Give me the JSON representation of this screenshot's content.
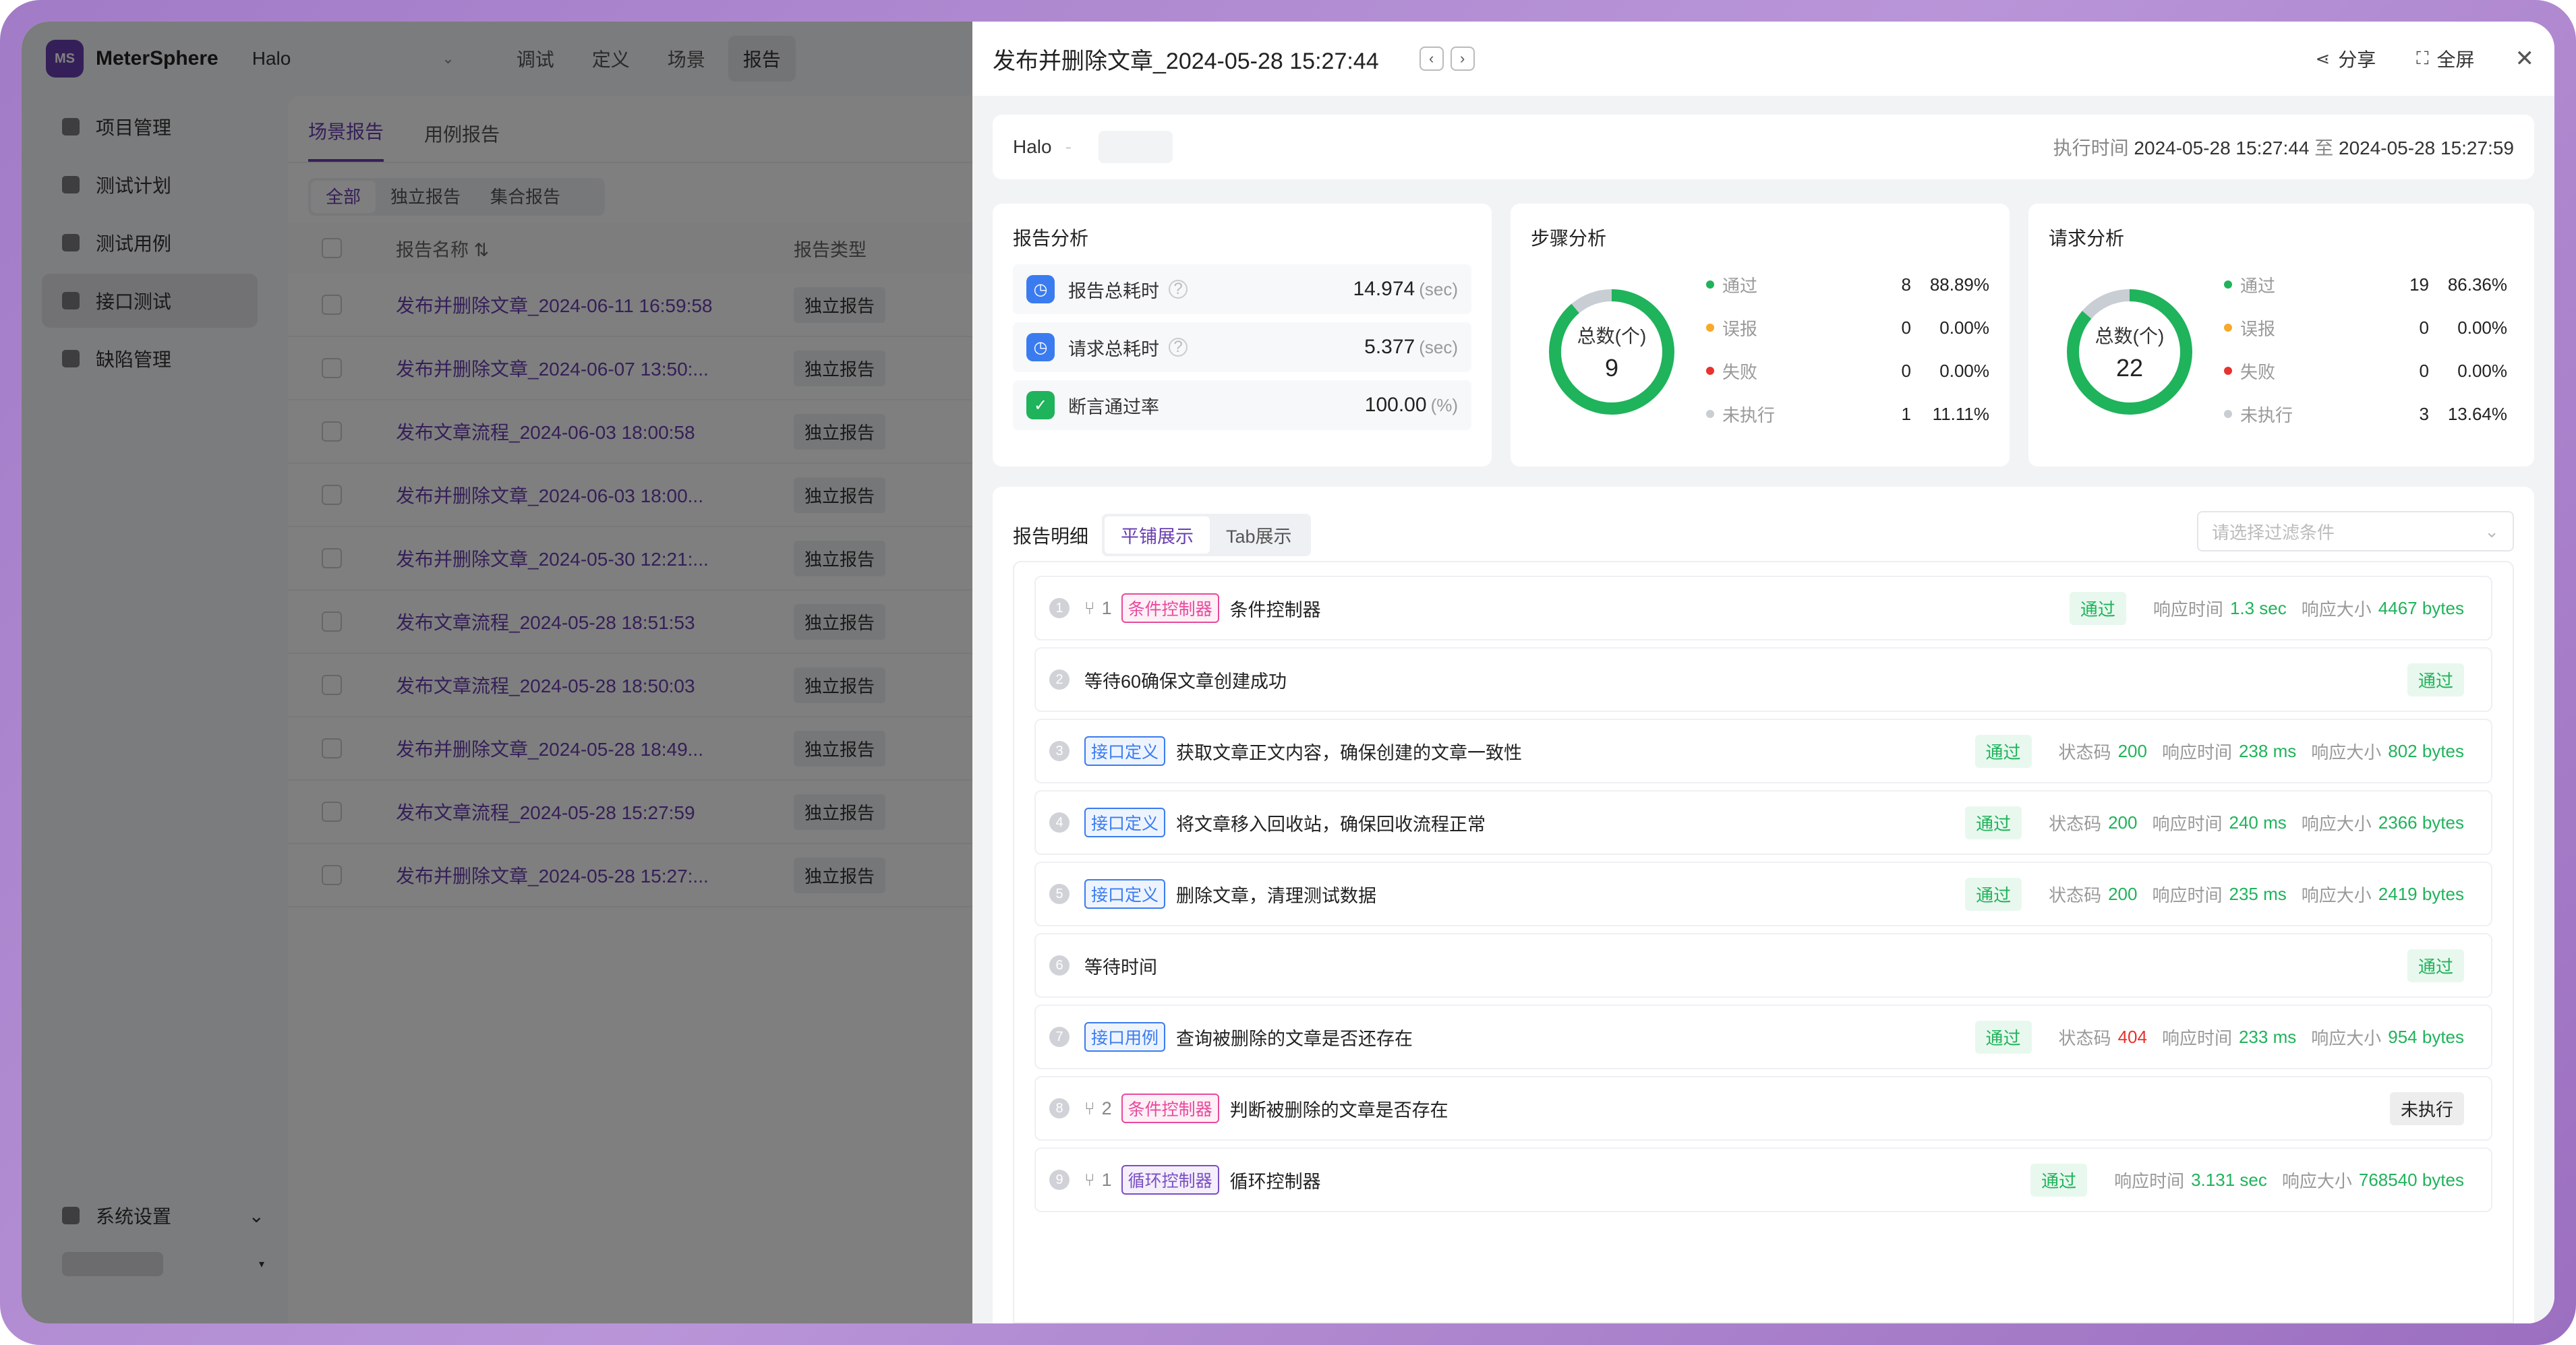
{
  "app": {
    "logo_text": "MeterSphere",
    "logo_badge": "MS",
    "project": "Halo",
    "top_nav": [
      "调试",
      "定义",
      "场景",
      "报告"
    ],
    "sidebar": [
      "项目管理",
      "测试计划",
      "测试用例",
      "接口测试",
      "缺陷管理"
    ],
    "sidebar_bottom": "系统设置",
    "tabs": [
      "场景报告",
      "用例报告"
    ],
    "segments": [
      "全部",
      "独立报告",
      "集合报告"
    ],
    "table_head": {
      "name": "报告名称",
      "type": "报告类型"
    },
    "rows": [
      {
        "name": "发布并删除文章_2024-06-11 16:59:58",
        "type": "独立报告"
      },
      {
        "name": "发布并删除文章_2024-06-07 13:50:...",
        "type": "独立报告"
      },
      {
        "name": "发布文章流程_2024-06-03 18:00:58",
        "type": "独立报告"
      },
      {
        "name": "发布并删除文章_2024-06-03 18:00...",
        "type": "独立报告"
      },
      {
        "name": "发布并删除文章_2024-05-30 12:21:...",
        "type": "独立报告"
      },
      {
        "name": "发布文章流程_2024-05-28 18:51:53",
        "type": "独立报告"
      },
      {
        "name": "发布文章流程_2024-05-28 18:50:03",
        "type": "独立报告"
      },
      {
        "name": "发布并删除文章_2024-05-28 18:49...",
        "type": "独立报告"
      },
      {
        "name": "发布文章流程_2024-05-28 15:27:59",
        "type": "独立报告"
      },
      {
        "name": "发布并删除文章_2024-05-28 15:27:...",
        "type": "独立报告"
      }
    ]
  },
  "drawer": {
    "title": "发布并删除文章_2024-05-28 15:27:44",
    "share": "分享",
    "fullscreen": "全屏",
    "info": {
      "project": "Halo",
      "dash": "-",
      "exec_label": "执行时间",
      "start": "2024-05-28 15:27:44",
      "to": "至",
      "end": "2024-05-28 15:27:59"
    },
    "report_analysis": {
      "title": "报告分析",
      "metrics": [
        {
          "label": "报告总耗时",
          "value": "14.974",
          "unit": "(sec)"
        },
        {
          "label": "请求总耗时",
          "value": "5.377",
          "unit": "(sec)"
        },
        {
          "label": "断言通过率",
          "value": "100.00",
          "unit": "(%)"
        }
      ]
    },
    "step_analysis": {
      "title": "步骤分析",
      "total_label": "总数(个)",
      "total": "9",
      "legend": [
        {
          "name": "通过",
          "count": "8",
          "pct": "88.89%"
        },
        {
          "name": "误报",
          "count": "0",
          "pct": "0.00%"
        },
        {
          "name": "失败",
          "count": "0",
          "pct": "0.00%"
        },
        {
          "name": "未执行",
          "count": "1",
          "pct": "11.11%"
        }
      ]
    },
    "request_analysis": {
      "title": "请求分析",
      "total_label": "总数(个)",
      "total": "22",
      "legend": [
        {
          "name": "通过",
          "count": "19",
          "pct": "86.36%"
        },
        {
          "name": "误报",
          "count": "0",
          "pct": "0.00%"
        },
        {
          "name": "失败",
          "count": "0",
          "pct": "0.00%"
        },
        {
          "name": "未执行",
          "count": "3",
          "pct": "13.64%"
        }
      ]
    },
    "detail": {
      "title": "报告明细",
      "views": [
        "平铺展示",
        "Tab展示"
      ],
      "filter_placeholder": "请选择过滤条件",
      "labels": {
        "status_code": "状态码",
        "resp_time": "响应时间",
        "resp_size": "响应大小"
      },
      "steps": [
        {
          "num": "1",
          "branch": "1",
          "tag": "条件控制器",
          "name": "条件控制器",
          "status": "通过",
          "time": "1.3 sec",
          "size": "4467 bytes"
        },
        {
          "num": "2",
          "name": "等待60确保文章创建成功",
          "status": "通过"
        },
        {
          "num": "3",
          "tag": "接口定义",
          "name": "获取文章正文内容，确保创建的文章一致性",
          "status": "通过",
          "code": "200",
          "time": "238 ms",
          "size": "802 bytes"
        },
        {
          "num": "4",
          "tag": "接口定义",
          "name": "将文章移入回收站，确保回收流程正常",
          "status": "通过",
          "code": "200",
          "time": "240 ms",
          "size": "2366 bytes"
        },
        {
          "num": "5",
          "tag": "接口定义",
          "name": "删除文章，清理测试数据",
          "status": "通过",
          "code": "200",
          "time": "235 ms",
          "size": "2419 bytes"
        },
        {
          "num": "6",
          "name": "等待时间",
          "status": "通过"
        },
        {
          "num": "7",
          "tag": "接口用例",
          "name": "查询被删除的文章是否还存在",
          "status": "通过",
          "code": "404",
          "time": "233 ms",
          "size": "954 bytes"
        },
        {
          "num": "8",
          "branch": "2",
          "tag": "条件控制器",
          "name": "判断被删除的文章是否存在",
          "status": "未执行"
        },
        {
          "num": "9",
          "branch": "1",
          "tag": "循环控制器",
          "name": "循环控制器",
          "status": "通过",
          "time": "3.131 sec",
          "size": "768540 bytes"
        }
      ]
    }
  },
  "colors": {
    "pass": "#1fb35b",
    "false_positive": "#f7a928",
    "fail": "#e8322e",
    "not_run": "#c9cdd4",
    "brand": "#6a3fb0"
  }
}
